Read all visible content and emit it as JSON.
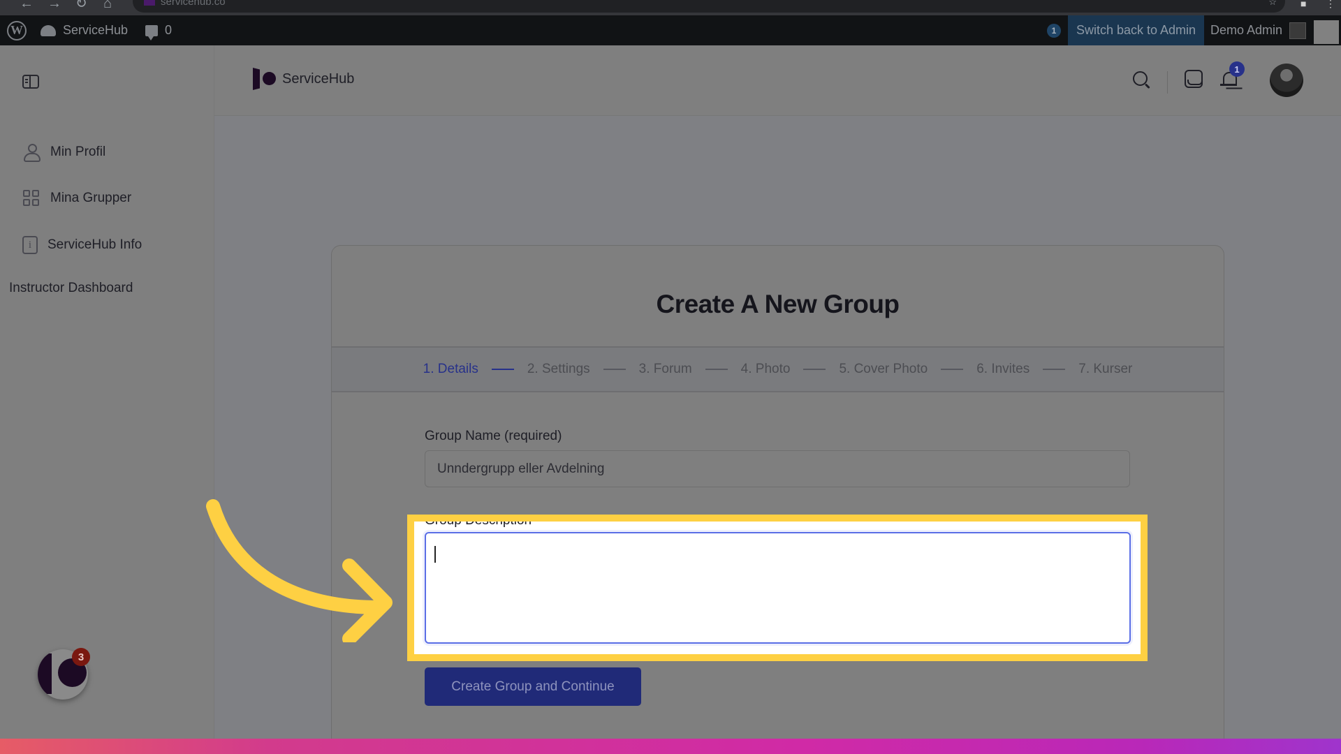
{
  "browser": {
    "url": "servicehub.co"
  },
  "wp_admin_bar": {
    "site_name": "ServiceHub",
    "comments_count": "0",
    "notification_count": "1",
    "switch_back_label": "Switch back to Admin",
    "user_name": "Demo Admin"
  },
  "sidebar": {
    "items": [
      {
        "label": "Min Profil",
        "icon": "person-icon"
      },
      {
        "label": "Mina Grupper",
        "icon": "grid-icon"
      },
      {
        "label": "ServiceHub Info",
        "icon": "info-icon"
      }
    ],
    "instructor_link": "Instructor Dashboard",
    "support_badge_count": "3"
  },
  "header": {
    "brand": "ServiceHub",
    "notification_count": "1"
  },
  "form": {
    "title": "Create A New Group",
    "steps": [
      {
        "label": "1. Details",
        "active": true
      },
      {
        "label": "2. Settings",
        "active": false
      },
      {
        "label": "3. Forum",
        "active": false
      },
      {
        "label": "4. Photo",
        "active": false
      },
      {
        "label": "5. Cover Photo",
        "active": false
      },
      {
        "label": "6. Invites",
        "active": false
      },
      {
        "label": "7. Kurser",
        "active": false
      }
    ],
    "group_name_label": "Group Name (required)",
    "group_name_value": "Unndergrupp eller Avdelning",
    "group_description_label": "Group Description",
    "group_description_value": "",
    "submit_label": "Create Group and Continue"
  },
  "annotation": {
    "highlight_color": "#fed043",
    "accent_color": "#27318a"
  }
}
